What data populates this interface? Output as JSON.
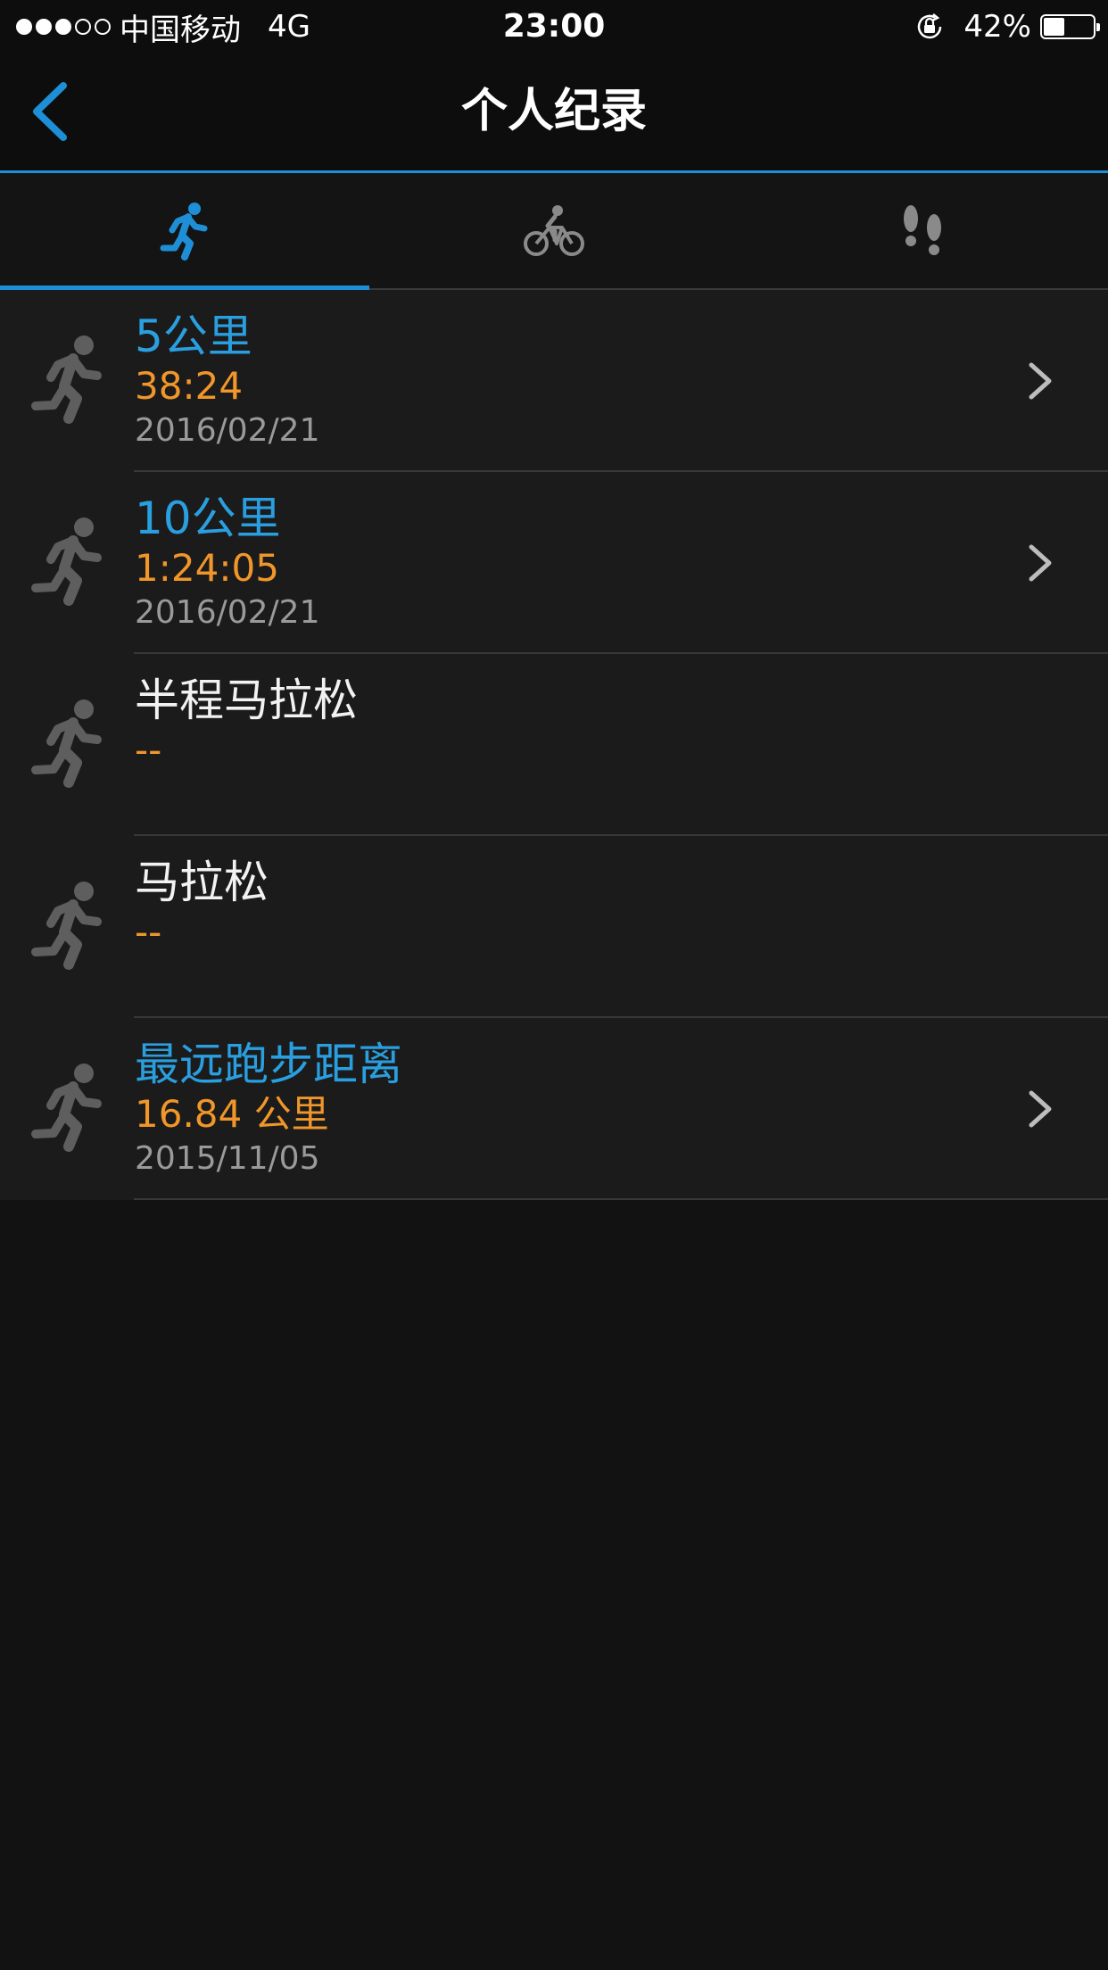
{
  "status_bar": {
    "carrier": "中国移动",
    "network": "4G",
    "time": "23:00",
    "battery_percent_text": "42%",
    "battery_level": 0.42
  },
  "nav": {
    "title": "个人纪录",
    "back_icon": "chevron-left-icon"
  },
  "tabs": [
    {
      "icon": "running-icon",
      "active": true
    },
    {
      "icon": "cycling-icon",
      "active": false
    },
    {
      "icon": "footprints-icon",
      "active": false
    }
  ],
  "records": [
    {
      "title": "5公里",
      "value": "38:24",
      "date": "2016/02/21",
      "has_record": true
    },
    {
      "title": "10公里",
      "value": "1:24:05",
      "date": "2016/02/21",
      "has_record": true
    },
    {
      "title": "半程马拉松",
      "value": "--",
      "date": "",
      "has_record": false
    },
    {
      "title": "马拉松",
      "value": "--",
      "date": "",
      "has_record": false
    },
    {
      "title": "最远跑步距离",
      "value": "16.84 公里",
      "date": "2015/11/05",
      "has_record": true
    }
  ],
  "colors": {
    "accent": "#1e8fd6",
    "title_blue": "#2a9fe0",
    "value_orange": "#f0962a",
    "date_gray": "#9a9a9a",
    "background": "#121212"
  }
}
